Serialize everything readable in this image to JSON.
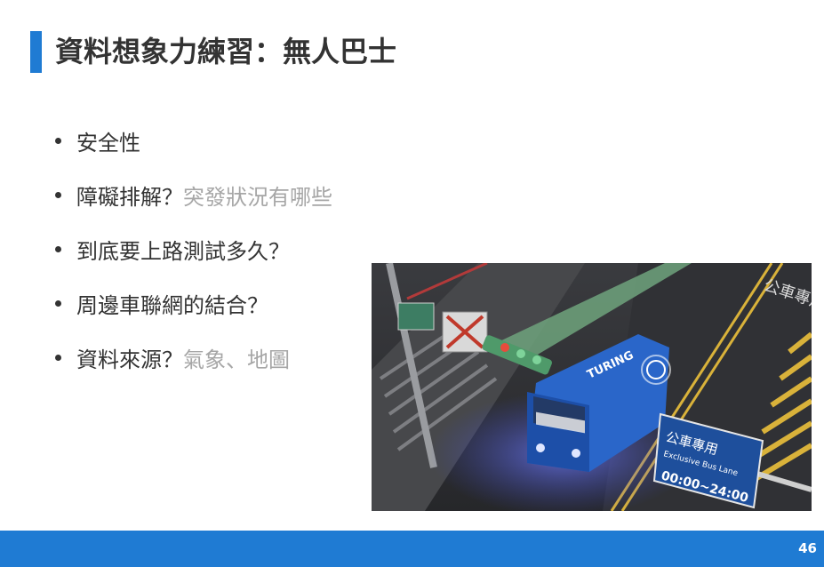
{
  "slide": {
    "title": "資料想象力練習：無人巴士",
    "bullets": [
      {
        "main": "安全性",
        "muted": ""
      },
      {
        "main": "障礙排解？",
        "muted": "突發狀況有哪些"
      },
      {
        "main": "到底要上路測試多久？",
        "muted": ""
      },
      {
        "main": "周邊車聯網的結合？",
        "muted": ""
      },
      {
        "main": "資料來源？",
        "muted": "氣象、地圖"
      }
    ],
    "page_number": "46"
  },
  "photo": {
    "bus_brand": "TURING",
    "road_marking": "公車專用",
    "sign_title": "公車專用",
    "sign_subtitle": "Exclusive Bus Lane",
    "sign_hours": "00:00~24:00"
  },
  "colors": {
    "accent": "#1f7bd3",
    "text": "#333333",
    "muted": "#a6a6a6"
  }
}
